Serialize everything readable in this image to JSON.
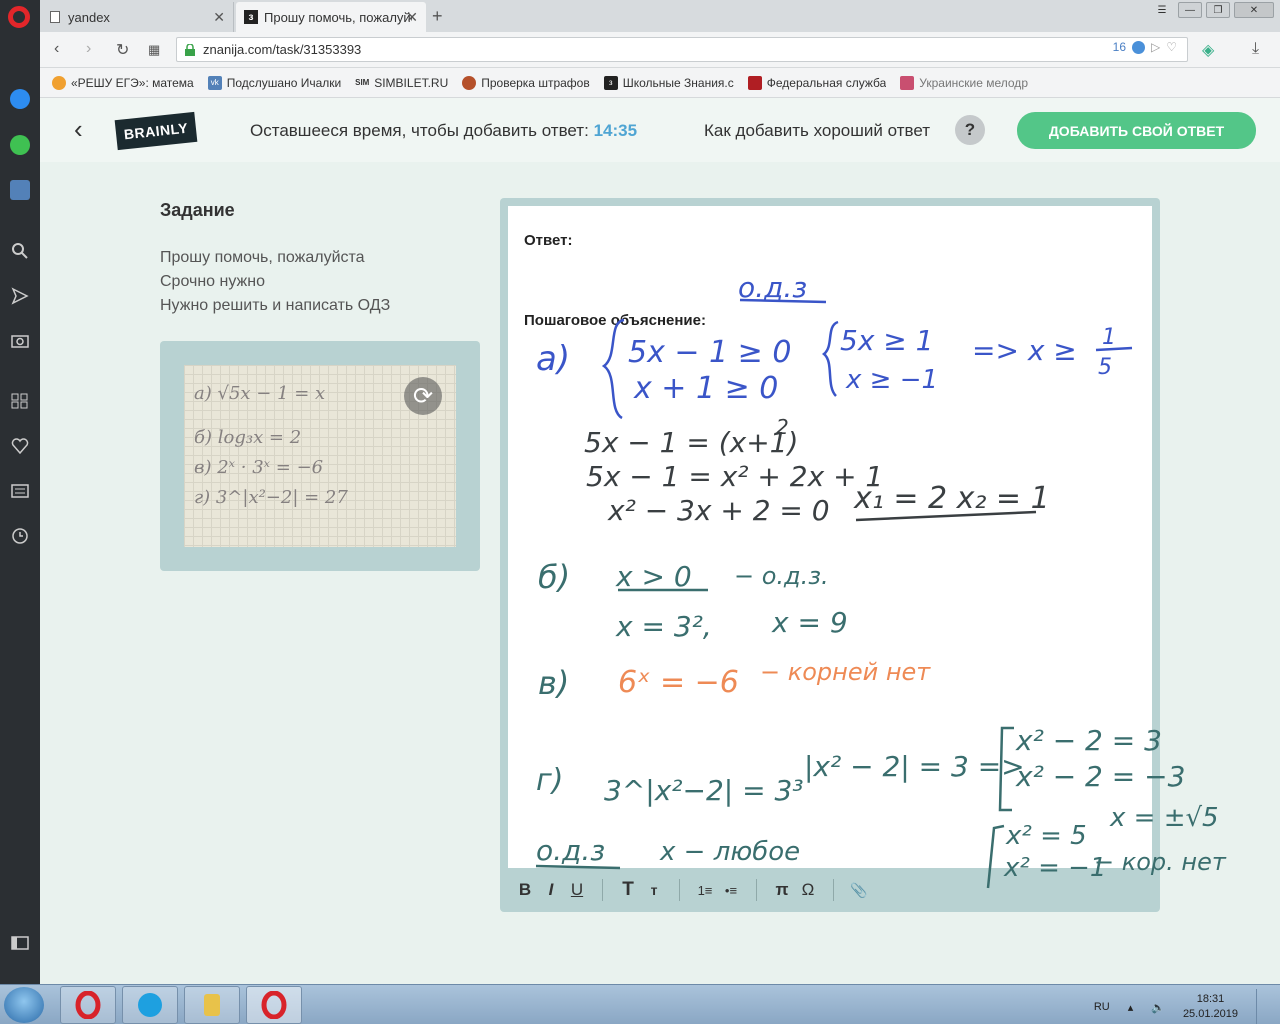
{
  "browser": {
    "tabs": [
      {
        "title": "yandex"
      },
      {
        "title": "Прошу помочь, пожалуйст"
      }
    ],
    "url": "znanija.com/task/31353393",
    "badge_count": "16",
    "bookmarks": [
      "«РЕШУ ЕГЭ»: матема",
      "Подслушано Ичалки",
      "SIMBILET.RU",
      "Проверка штрафов",
      "Школьные Знания.с",
      "Федеральная служба",
      "Украинские мелодр"
    ]
  },
  "header": {
    "logo": "BRAINLY",
    "timer_label": "Оставшееся время, чтобы добавить ответ:",
    "timer_value": "14:35",
    "howto": "Как добавить хороший ответ",
    "help_symbol": "?",
    "add_answer": "ДОБАВИТЬ СВОЙ ОТВЕТ"
  },
  "task": {
    "title": "Задание",
    "lines": [
      "Прошу помочь, пожалуйста",
      "Срочно нужно",
      "Нужно решить и написать ОДЗ"
    ],
    "photo_lines": [
      "а) √5x − 1 = x",
      "б) log₃x = 2",
      "в) 2ˣ · 3ˣ = −6",
      "г) 3^|x²−2| = 27"
    ]
  },
  "answer": {
    "answer_label": "Ответ:",
    "step_label": "Пошаговое объяснение:"
  },
  "handwriting": {
    "odz_title": "о.д.з",
    "a_label": "а)",
    "a_sys1": "5x − 1 ≥ 0",
    "a_sys2": "x + 1 ≥ 0",
    "a_sys3": "5x ≥ 1",
    "a_sys4": "x ≥ −1",
    "a_result": "=> x ≥",
    "a_num": "1",
    "a_den": "5",
    "a_eq1": "5x − 1 = (x+1)",
    "a_eq1_sup": "2",
    "a_eq2": "5x − 1 = x² + 2x + 1",
    "a_eq3": "x² − 3x + 2 = 0",
    "a_roots": "x₁ = 2   x₂ = 1",
    "b_label": "б)",
    "b_odz": "x > 0",
    "b_odz_note": "− о.д.з.",
    "b_eq": "x = 3²,",
    "b_res": "x = 9",
    "v_label": "в)",
    "v_eq": "6ˣ = −6",
    "v_note": "− корней нет",
    "g_label": "г)",
    "g_eq": "3^|x²−2| = 3³",
    "g_mod": "|x² − 2| = 3 =>",
    "g_c1": "x² − 2 = 3",
    "g_c2": "x² − 2 = −3",
    "g_odz": "о.д.з",
    "g_odz_note": "x − любое",
    "g_r1": "x² = 5",
    "g_r1b": "x = ±√5",
    "g_r2": "x² = −1",
    "g_r2b": "− кор. нет"
  },
  "colors": {
    "blue": "#3a55c8",
    "dark": "#3a3f42",
    "teal": "#3a6e6e",
    "orange": "#ee8a55",
    "accent": "#53c688",
    "timer": "#4fa5d3"
  },
  "toolbar": [
    "B",
    "I",
    "U",
    "T",
    "т",
    "1≡",
    "•≡",
    "π",
    "Ω",
    "📎"
  ],
  "taskbar": {
    "lang": "RU",
    "time": "18:31",
    "date": "25.01.2019"
  }
}
